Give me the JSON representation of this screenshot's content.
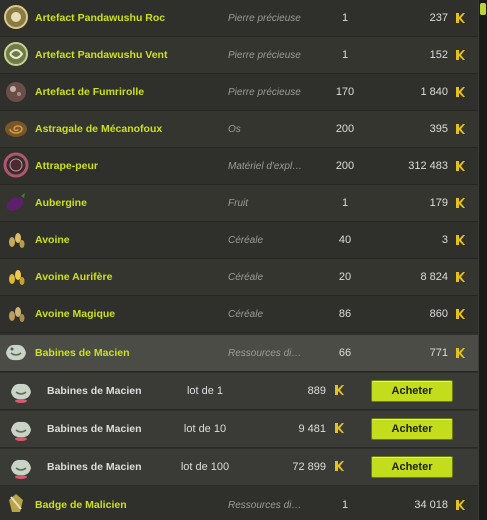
{
  "items": [
    {
      "name": "Artefact Pandawushu Roc",
      "category": "Pierre précieuse",
      "qty": "1",
      "price": "237",
      "icon": "roc-rune-icon"
    },
    {
      "name": "Artefact Pandawushu Vent",
      "category": "Pierre précieuse",
      "qty": "1",
      "price": "152",
      "icon": "wind-rune-icon"
    },
    {
      "name": "Artefact de Fumrirolle",
      "category": "Pierre précieuse",
      "qty": "170",
      "price": "1 840",
      "icon": "fumrirolle-icon"
    },
    {
      "name": "Astragale de Mécanofoux",
      "category": "Os",
      "qty": "200",
      "price": "395",
      "icon": "spiral-bone-icon"
    },
    {
      "name": "Attrape-peur",
      "category": "Matériel d'expl…",
      "qty": "200",
      "price": "312 483",
      "icon": "dreamcatcher-icon"
    },
    {
      "name": "Aubergine",
      "category": "Fruit",
      "qty": "1",
      "price": "179",
      "icon": "eggplant-icon"
    },
    {
      "name": "Avoine",
      "category": "Céréale",
      "qty": "40",
      "price": "3",
      "icon": "oat-icon"
    },
    {
      "name": "Avoine Aurifère",
      "category": "Céréale",
      "qty": "20",
      "price": "8 824",
      "icon": "golden-oat-icon"
    },
    {
      "name": "Avoine Magique",
      "category": "Céréale",
      "qty": "86",
      "price": "860",
      "icon": "magic-oat-icon"
    },
    {
      "name": "Babines de Macien",
      "category": "Ressources di…",
      "qty": "66",
      "price": "771",
      "icon": "babines-icon"
    }
  ],
  "lots": [
    {
      "name": "Babines de Macien",
      "lot": "lot de 1",
      "price": "889",
      "button": "Acheter"
    },
    {
      "name": "Babines de Macien",
      "lot": "lot de 10",
      "price": "9 481",
      "button": "Acheter"
    },
    {
      "name": "Babines de Macien",
      "lot": "lot de 100",
      "price": "72 899",
      "button": "Acheter"
    }
  ],
  "last_item": {
    "name": "Badge de Malicien",
    "category": "Ressources di…",
    "qty": "1",
    "price": "34 018",
    "icon": "badge-icon"
  },
  "colors": {
    "name": "#cce11b",
    "button": "#c3dd1c",
    "selected_row": "#4a4c45",
    "kama": "#e3c11e"
  }
}
